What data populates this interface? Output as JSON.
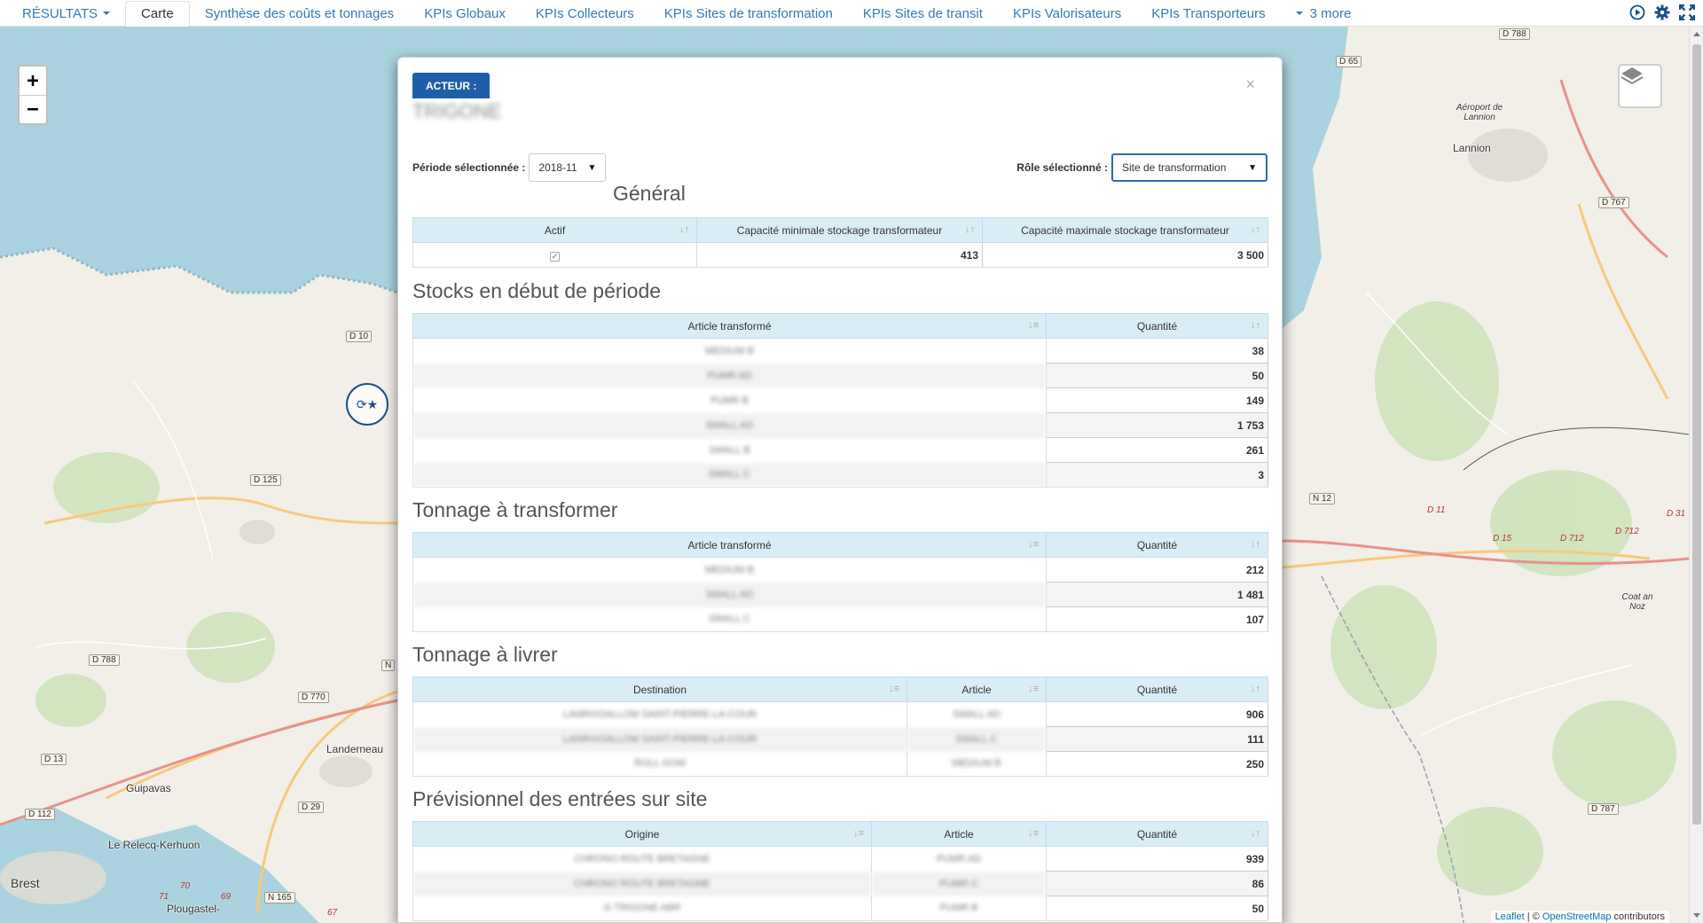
{
  "nav": {
    "resultats": "RÉSULTATS",
    "tabs": [
      "Carte",
      "Synthèse des coûts et tonnages",
      "KPIs Globaux",
      "KPIs Collecteurs",
      "KPIs Sites de transformation",
      "KPIs Sites de transit",
      "KPIs Valorisateurs",
      "KPIs Transporteurs"
    ],
    "more": "3 more",
    "icons": [
      "play-circle-icon",
      "gear-icon",
      "fullscreen-icon"
    ]
  },
  "map": {
    "zoom_in": "+",
    "zoom_out": "−",
    "attribution_leaflet": "Leaflet",
    "attribution_sep": " | © ",
    "attribution_osm": "OpenStreetMap",
    "attribution_rest": " contributors",
    "places": {
      "lannion": "Lannion",
      "aeroport": "Aéroport de Lannion",
      "landerneau": "Landerneau",
      "guipavas": "Guipavas",
      "relecq": "Le Relecq-Kerhuon",
      "brest": "Brest",
      "plougastel": "Plougastel-",
      "coat": "Coat an Noz"
    },
    "roads": {
      "d788_top": "D 788",
      "d65": "D 65",
      "d767": "D 767",
      "d10": "D 10",
      "d125": "D 125",
      "n12": "N 12",
      "d788_left": "D 788",
      "d770": "D 770",
      "d13": "D 13",
      "d112": "D 112",
      "d29": "D 29",
      "n165": "N 165",
      "d787": "D 787",
      "n_edge": "N",
      "d11": "D 11",
      "d15": "D 15",
      "d712a": "D 712",
      "d712b": "D 712",
      "d31": "D 31",
      "r69": "69",
      "r71": "71",
      "r70": "70",
      "r67": "67"
    }
  },
  "modal": {
    "acteur_label": "ACTEUR :",
    "actor_name": "TRIGONE",
    "close": "×",
    "period_label": "Période sélectionnée :",
    "period_value": "2018-11",
    "role_label": "Rôle sélectionné :",
    "role_value": "Site de transformation",
    "general": {
      "title": "Général",
      "headers": [
        "Actif",
        "Capacité minimale stockage transformateur",
        "Capacité maximale stockage transformateur"
      ],
      "row": {
        "actif": "✓",
        "min": "413",
        "max": "3 500"
      }
    },
    "stocks": {
      "title": "Stocks en début de période",
      "headers": [
        "Article transformé",
        "Quantité"
      ],
      "rows": [
        {
          "article": "MEDIUM B",
          "qty": "38"
        },
        {
          "article": "PUMR AD",
          "qty": "50"
        },
        {
          "article": "PUMR B",
          "qty": "149"
        },
        {
          "article": "SMALL AD",
          "qty": "1 753"
        },
        {
          "article": "SMALL B",
          "qty": "261"
        },
        {
          "article": "SMALL C",
          "qty": "3"
        }
      ]
    },
    "tonnage_transformer": {
      "title": "Tonnage à transformer",
      "headers": [
        "Article transformé",
        "Quantité"
      ],
      "rows": [
        {
          "article": "MEDIUM B",
          "qty": "212"
        },
        {
          "article": "SMALL AD",
          "qty": "1 481"
        },
        {
          "article": "SMALL C",
          "qty": "107"
        }
      ]
    },
    "tonnage_livrer": {
      "title": "Tonnage à livrer",
      "headers": [
        "Destination",
        "Article",
        "Quantité"
      ],
      "rows": [
        {
          "dest": "LANRIVOALLOM SAINT-PIERRE-LA-COUR",
          "article": "SMALL AD",
          "qty": "906"
        },
        {
          "dest": "LANRIVOALLOM SAINT-PIERRE-LA-COUR",
          "article": "SMALL C",
          "qty": "111"
        },
        {
          "dest": "ROLL GOM",
          "article": "MEDIUM B",
          "qty": "250"
        }
      ]
    },
    "previsionnel": {
      "title": "Prévisionnel des entrées sur site",
      "headers": [
        "Origine",
        "Article",
        "Quantité"
      ],
      "rows": [
        {
          "origin": "CHRONO ROUTE BRETAGNE",
          "article": "PUMR AD",
          "qty": "939"
        },
        {
          "origin": "CHRONO ROUTE BRETAGNE",
          "article": "PUMR C",
          "qty": "86"
        },
        {
          "origin": "G TRIGONE ABR",
          "article": "PUMR B",
          "qty": "50"
        }
      ]
    }
  }
}
